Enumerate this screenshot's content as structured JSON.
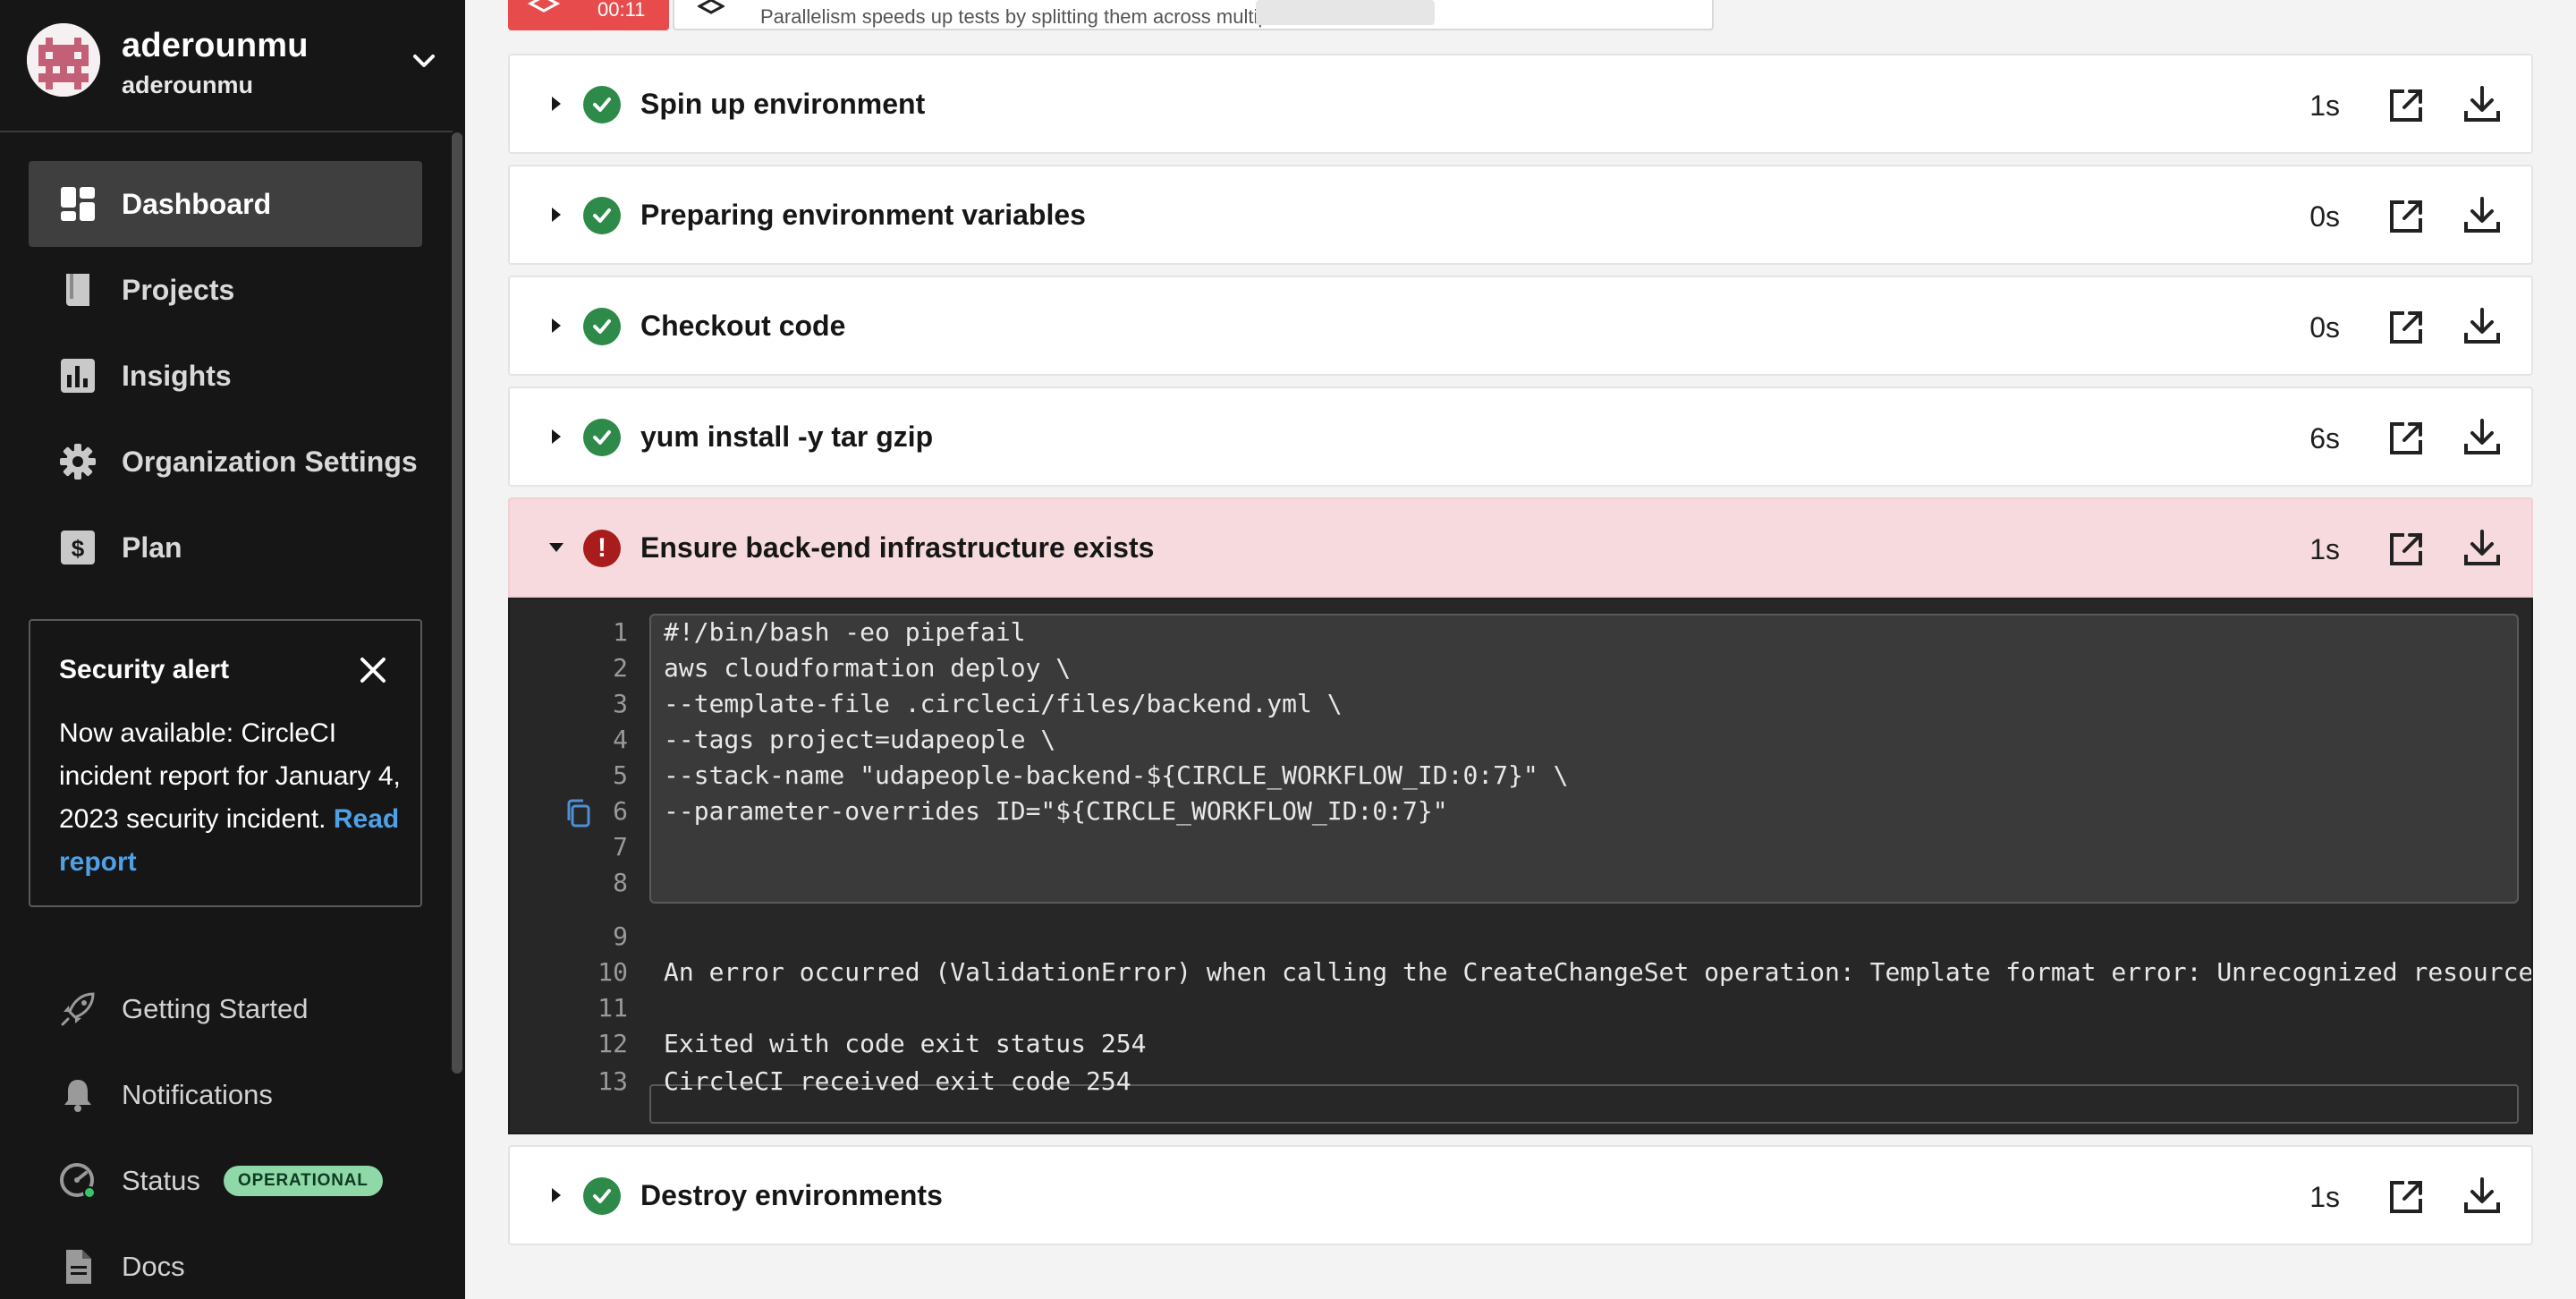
{
  "sidebar": {
    "org_name": "aderounmu",
    "org_sub": "aderounmu",
    "nav": [
      {
        "label": "Dashboard",
        "icon": "dashboard-icon",
        "active": true
      },
      {
        "label": "Projects",
        "icon": "book-icon"
      },
      {
        "label": "Insights",
        "icon": "bar-chart-icon"
      },
      {
        "label": "Organization Settings",
        "icon": "gear-icon"
      },
      {
        "label": "Plan",
        "icon": "dollar-icon"
      }
    ],
    "alert": {
      "title": "Security alert",
      "body": "Now available: CircleCI incident report for January 4, 2023 security incident.",
      "link": "Read report"
    },
    "bottom_nav": [
      {
        "label": "Getting Started",
        "icon": "rocket-icon"
      },
      {
        "label": "Notifications",
        "icon": "bell-icon"
      },
      {
        "label": "Status",
        "icon": "gauge-icon",
        "badge": "OPERATIONAL"
      },
      {
        "label": "Docs",
        "icon": "document-icon"
      }
    ]
  },
  "topbar": {
    "timer": "00:11",
    "tip": "Parallelism speeds up tests by splitting them across multiple executors."
  },
  "steps": [
    {
      "title": "Spin up environment",
      "duration": "1s",
      "status": "success"
    },
    {
      "title": "Preparing environment variables",
      "duration": "0s",
      "status": "success"
    },
    {
      "title": "Checkout code",
      "duration": "0s",
      "status": "success"
    },
    {
      "title": "yum install -y tar gzip",
      "duration": "6s",
      "status": "success"
    },
    {
      "title": "Ensure back-end infrastructure exists",
      "duration": "1s",
      "status": "failed"
    },
    {
      "title": "Destroy environments",
      "duration": "1s",
      "status": "success"
    }
  ],
  "console": {
    "lines": [
      {
        "n": "1",
        "text": "#!/bin/bash -eo pipefail"
      },
      {
        "n": "2",
        "text": "aws cloudformation deploy \\"
      },
      {
        "n": "3",
        "text": "--template-file .circleci/files/backend.yml \\"
      },
      {
        "n": "4",
        "text": "--tags project=udapeople \\"
      },
      {
        "n": "5",
        "text": "--stack-name \"udapeople-backend-${CIRCLE_WORKFLOW_ID:0:7}\" \\"
      },
      {
        "n": "6",
        "text": "--parameter-overrides ID=\"${CIRCLE_WORKFLOW_ID:0:7}\""
      },
      {
        "n": "7",
        "text": ""
      },
      {
        "n": "8",
        "text": ""
      },
      {
        "n": "9",
        "text": ""
      },
      {
        "n": "10",
        "text": "An error occurred (ValidationError) when calling the CreateChangeSet operation: Template format error: Unrecognized resource"
      },
      {
        "n": "11",
        "text": ""
      },
      {
        "n": "12",
        "text": "Exited with code exit status 254"
      },
      {
        "n": "13",
        "text": "CircleCI received exit code 254"
      }
    ]
  },
  "colors": {
    "success": "#2e8a49",
    "error": "#a81c1c",
    "failed_bg": "#f6dadd",
    "link": "#4ea1e6",
    "sidebar_bg": "#161616"
  }
}
